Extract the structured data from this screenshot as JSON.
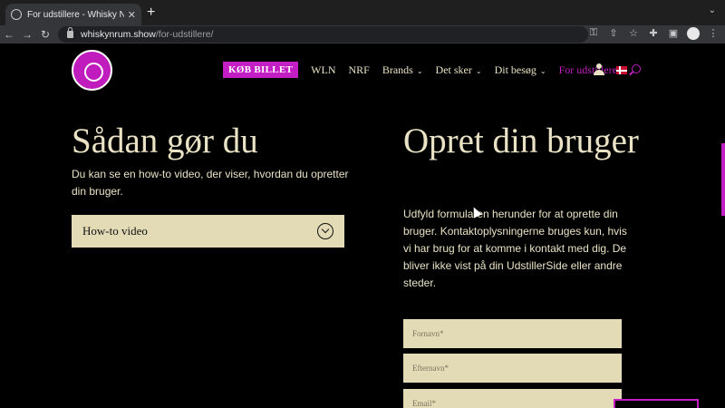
{
  "browser": {
    "tab_title": "For udstillere - Whisky N Rum",
    "url_host": "whiskynrum.show",
    "url_path": "/for-udstillere/"
  },
  "header": {
    "buy_label": "KØB BILLET",
    "nav": {
      "wln": "WLN",
      "nrf": "NRF",
      "brands": "Brands",
      "events": "Det sker",
      "visit": "Dit besøg",
      "exhibitors": "For udstillere"
    },
    "accent_color": "#c31ec3"
  },
  "left": {
    "heading": "Sådan gør du",
    "text": "Du kan se en how-to video, der viser, hvordan du opretter din bruger.",
    "accordion_label": "How-to video"
  },
  "right": {
    "heading": "Opret din bruger",
    "text": "Udfyld formularen herunder for at oprette din bruger. Kontaktoplysningerne bruges kun, hvis vi har brug for at komme i kontakt med dig. De bliver ikke vist på din UdstillerSide eller andre steder."
  },
  "form": {
    "firstname_placeholder": "Fornavn*",
    "lastname_placeholder": "Efternavn*",
    "email_placeholder": "Email*"
  }
}
